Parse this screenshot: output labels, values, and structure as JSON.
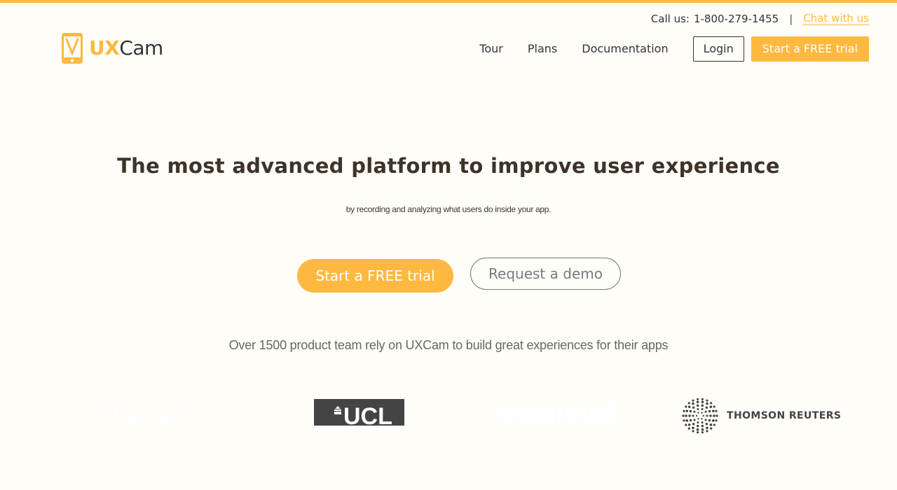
{
  "header": {
    "contact_label": "Call us:",
    "phone": "1-800-279-1455",
    "separator": "|",
    "chat_link": "Chat with us"
  },
  "logo": {
    "ux": "UX",
    "cam": "Cam"
  },
  "nav": {
    "items": [
      {
        "label": "Tour"
      },
      {
        "label": "Plans"
      },
      {
        "label": "Documentation"
      }
    ],
    "login": "Login",
    "trial": "Start a FREE trial"
  },
  "hero": {
    "title": "The most advanced platform to improve user experience",
    "subtitle": "by recording and analyzing what users do inside your app.",
    "cta_primary": "Start a FREE trial",
    "cta_secondary": "Request a demo"
  },
  "trust": {
    "text": "Over 1500 product team rely on UXCam to build great experiences for their apps"
  },
  "clients": {
    "ucl": "UCL",
    "thomson": "THOMSON REUTERS"
  },
  "colors": {
    "accent": "#ffb840",
    "background": "#fffdf8",
    "text": "#3d3429"
  }
}
